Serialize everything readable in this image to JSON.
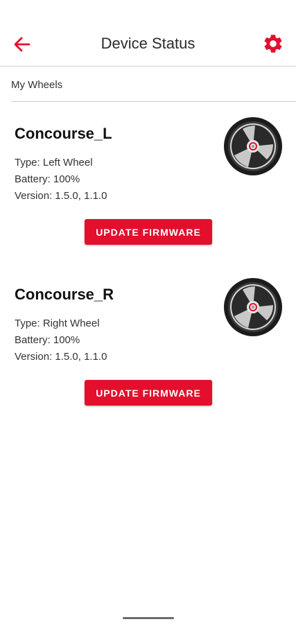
{
  "header": {
    "title": "Device Status",
    "back_icon": "arrow-left-icon",
    "settings_icon": "gear-icon",
    "accent_color": "#e30f2d"
  },
  "section": {
    "label": "My Wheels"
  },
  "devices": [
    {
      "name": "Concourse_L",
      "type": "Type: Left Wheel",
      "battery": "Battery: 100%",
      "version": "Version: 1.5.0, 1.1.0",
      "button_label": "UPDATE FIRMWARE",
      "image_icon": "wheel-icon"
    },
    {
      "name": "Concourse_R",
      "type": "Type: Right Wheel",
      "battery": "Battery: 100%",
      "version": "Version: 1.5.0, 1.1.0",
      "button_label": "UPDATE FIRMWARE",
      "image_icon": "wheel-icon"
    }
  ]
}
